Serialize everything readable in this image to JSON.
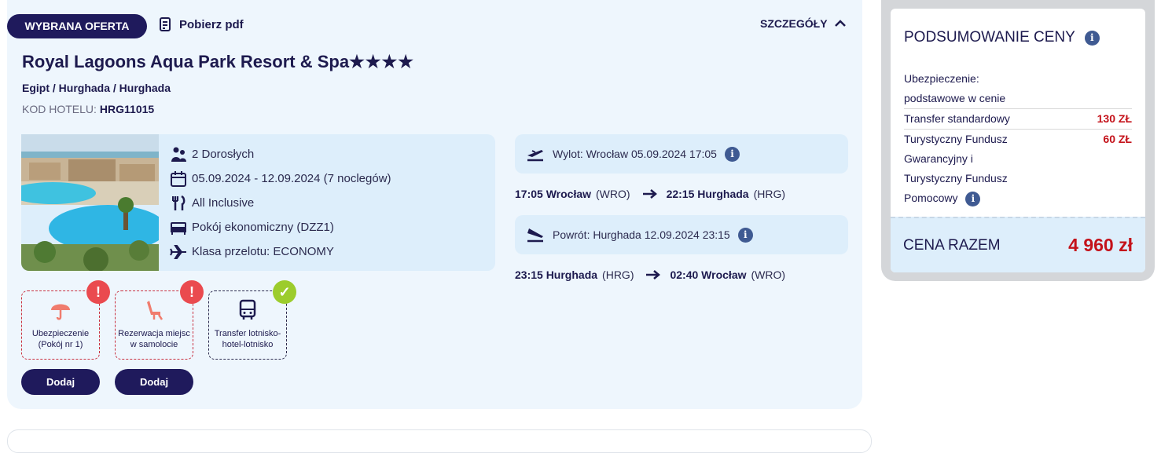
{
  "offer": {
    "badge": "WYBRANA OFERTA",
    "pdf_label": "Pobierz pdf",
    "details_label": "SZCZEGÓŁY",
    "hotel_name": "Royal Lagoons Aqua Park Resort & Spa",
    "stars_text": "★★★★",
    "stars": 4,
    "location": "Egipt / Hurghada / Hurghada",
    "code_label": "KOD HOTELU:",
    "code_value": "HRG11015"
  },
  "details": {
    "travelers": "2 Dorosłych",
    "dates": "05.09.2024 - 12.09.2024 (7 noclegów)",
    "board": "All Inclusive",
    "room": "Pokój ekonomiczny (DZZ1)",
    "flight_class": "Klasa przelotu: ECONOMY"
  },
  "flights": {
    "outbound_summary": "Wylot: Wrocław 05.09.2024 17:05",
    "outbound": {
      "dep_time_city": "17:05 Wrocław",
      "dep_code": "(WRO)",
      "arr_time_city": "22:15 Hurghada",
      "arr_code": "(HRG)"
    },
    "return_summary": "Powrót: Hurghada 12.09.2024 23:15",
    "return": {
      "dep_time_city": "23:15 Hurghada",
      "dep_code": "(HRG)",
      "arr_time_city": "02:40 Wrocław",
      "arr_code": "(WRO)"
    }
  },
  "extras": [
    {
      "label_line1": "Ubezpieczenie",
      "label_line2": "(Pokój nr 1)",
      "status": "warning",
      "flag": "!"
    },
    {
      "label_line1": "Rezerwacja miejsc",
      "label_line2": "w samolocie",
      "status": "warning",
      "flag": "!"
    },
    {
      "label_line1": "Transfer lotnisko-",
      "label_line2": "hotel-lotnisko",
      "status": "ok",
      "flag": "✓"
    }
  ],
  "buttons": {
    "add_1": "Dodaj",
    "add_2": "Dodaj"
  },
  "price": {
    "title": "PODSUMOWANIE CENY",
    "insurance_label_1": "Ubezpieczenie:",
    "insurance_label_2": "podstawowe w cenie",
    "transfer_label": "Transfer standardowy",
    "transfer_amount": "130 ZŁ",
    "fund_label_1": "Turystyczny Fundusz",
    "fund_label_2": "Gwarancyjny i",
    "fund_label_3": "Turystyczny Fundusz",
    "fund_label_4": "Pomocowy",
    "fund_amount": "60 ZŁ",
    "total_label": "CENA RAZEM",
    "total_value": "4 960 zł"
  },
  "colors": {
    "navy": "#1f1a5c",
    "accent_red": "#c4121a",
    "warn": "#ea4a4f",
    "ok": "#9ccc2c",
    "card_bg": "#eef6fd",
    "box_bg": "#ddeefb"
  }
}
